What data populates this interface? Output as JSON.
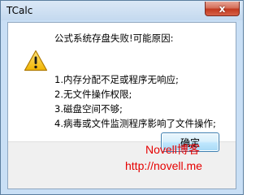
{
  "window": {
    "title": "TCalc",
    "close_glyph": "x"
  },
  "dialog": {
    "icon": "warning-icon",
    "message_lines": [
      "公式系统存盘失败!可能原因:",
      "1.内存分配不足或程序无响应;",
      "2.无文件操作权限;",
      "3.磁盘空间不够;",
      "4.病毒或文件监测程序影响了文件操作;"
    ],
    "ok_label": "确定"
  },
  "watermark": {
    "line1": "Novell博客",
    "line2": "http://novell.me",
    "color": "#e60000"
  },
  "colors": {
    "frame": "#c9dff5",
    "close_button": "#c2391f",
    "ok_button_border": "#3c7fb1"
  }
}
